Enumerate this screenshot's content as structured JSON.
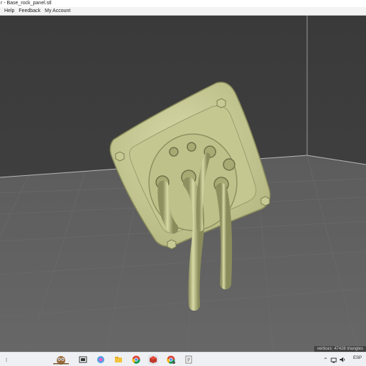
{
  "window": {
    "title": "r - Base_rock_panel.stl"
  },
  "menu": {
    "items": [
      "Help",
      "Feedback",
      "My Account"
    ]
  },
  "viewport": {
    "background_color": "#3c3c3c",
    "floor_color": "#5a5a5a",
    "model_color": "#c9cb96",
    "status_text": "vertices: 47428 triangles"
  },
  "taskbar": {
    "language": "ESP",
    "icons": [
      "owl-widget-icon",
      "task-view-icon",
      "copilot-icon",
      "file-explorer-icon",
      "chrome-icon",
      "slicer-app-icon",
      "chrome-profile-icon",
      "notepad-icon"
    ],
    "tray": [
      "chevron-up-icon",
      "network-icon",
      "volume-icon"
    ]
  }
}
